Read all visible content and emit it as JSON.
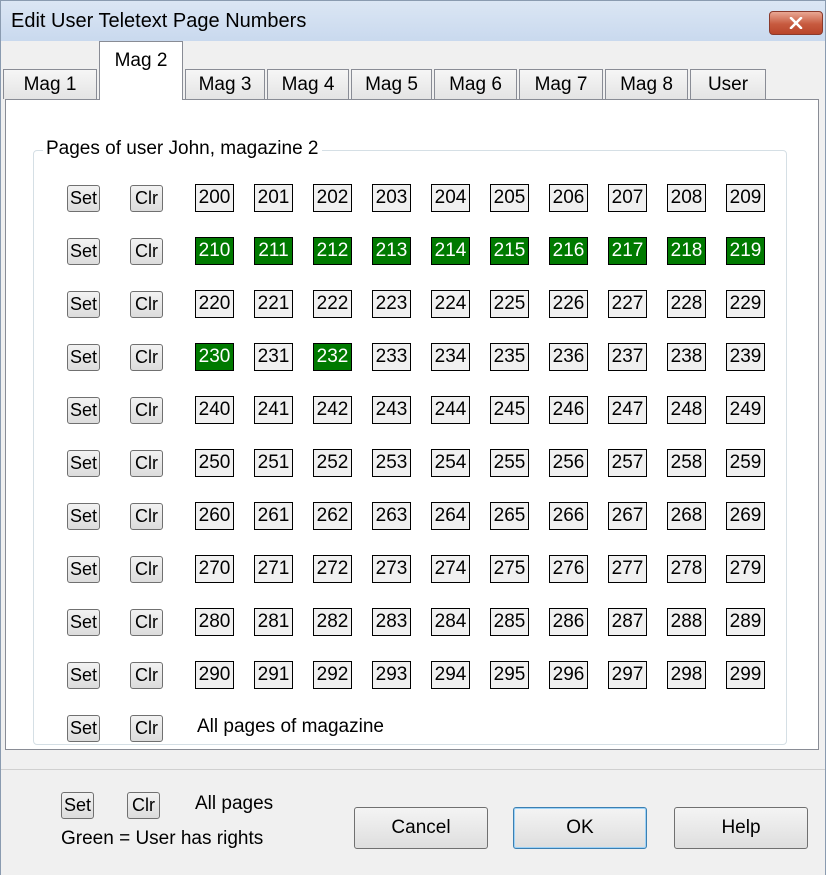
{
  "window": {
    "title": "Edit User Teletext Page Numbers"
  },
  "tabs": [
    "Mag 1",
    "Mag 2",
    "Mag 3",
    "Mag 4",
    "Mag 5",
    "Mag 6",
    "Mag 7",
    "Mag 8",
    "User"
  ],
  "active_tab": "Mag 2",
  "group": {
    "legend": "Pages of user John,  magazine 2",
    "set_label": "Set",
    "clr_label": "Clr",
    "all_pages_of_magazine": "All pages of magazine",
    "rows": [
      [
        "200",
        "201",
        "202",
        "203",
        "204",
        "205",
        "206",
        "207",
        "208",
        "209"
      ],
      [
        "210",
        "211",
        "212",
        "213",
        "214",
        "215",
        "216",
        "217",
        "218",
        "219"
      ],
      [
        "220",
        "221",
        "222",
        "223",
        "224",
        "225",
        "226",
        "227",
        "228",
        "229"
      ],
      [
        "230",
        "231",
        "232",
        "233",
        "234",
        "235",
        "236",
        "237",
        "238",
        "239"
      ],
      [
        "240",
        "241",
        "242",
        "243",
        "244",
        "245",
        "246",
        "247",
        "248",
        "249"
      ],
      [
        "250",
        "251",
        "252",
        "253",
        "254",
        "255",
        "256",
        "257",
        "258",
        "259"
      ],
      [
        "260",
        "261",
        "262",
        "263",
        "264",
        "265",
        "266",
        "267",
        "268",
        "269"
      ],
      [
        "270",
        "271",
        "272",
        "273",
        "274",
        "275",
        "276",
        "277",
        "278",
        "279"
      ],
      [
        "280",
        "281",
        "282",
        "283",
        "284",
        "285",
        "286",
        "287",
        "288",
        "289"
      ],
      [
        "290",
        "291",
        "292",
        "293",
        "294",
        "295",
        "296",
        "297",
        "298",
        "299"
      ]
    ],
    "granted_pages": [
      "210",
      "211",
      "212",
      "213",
      "214",
      "215",
      "216",
      "217",
      "218",
      "219",
      "230",
      "232"
    ]
  },
  "footer": {
    "set_label": "Set",
    "clr_label": "Clr",
    "all_pages": "All pages",
    "legend": "Green = User has rights",
    "cancel": "Cancel",
    "ok": "OK",
    "help": "Help"
  },
  "colors": {
    "granted": "#007a00",
    "titlebar": "#c9d9ee",
    "close_button": "#c75a3f"
  }
}
